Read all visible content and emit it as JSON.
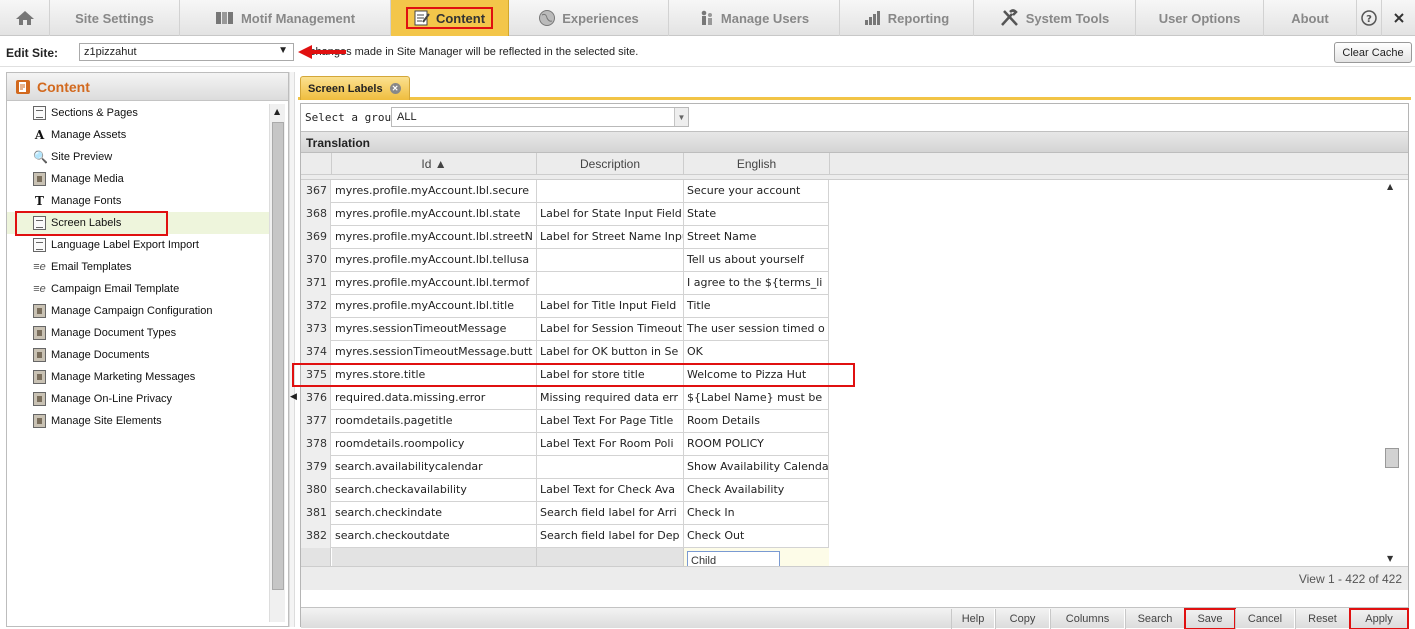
{
  "nav": {
    "items": [
      {
        "key": "home",
        "label": "",
        "icon": "home-icon"
      },
      {
        "key": "site_settings",
        "label": "Site Settings",
        "icon": ""
      },
      {
        "key": "motif",
        "label": "Motif Management",
        "icon": "motif-icon"
      },
      {
        "key": "content",
        "label": "Content",
        "icon": "content-icon",
        "active": true
      },
      {
        "key": "experiences",
        "label": "Experiences",
        "icon": "globe-icon"
      },
      {
        "key": "manage_users",
        "label": "Manage Users",
        "icon": "users-icon"
      },
      {
        "key": "reporting",
        "label": "Reporting",
        "icon": "bar-chart-icon"
      },
      {
        "key": "system_tools",
        "label": "System Tools",
        "icon": "tools-icon"
      },
      {
        "key": "user_options",
        "label": "User Options",
        "icon": ""
      },
      {
        "key": "about",
        "label": "About",
        "icon": ""
      },
      {
        "key": "help",
        "label": "",
        "icon": "help-icon"
      }
    ]
  },
  "editbar": {
    "label": "Edit Site:",
    "site_value": "z1pizzahut",
    "message": "changes made in Site Manager will be reflected in the selected site.",
    "clear_cache": "Clear Cache"
  },
  "left": {
    "title": "Content",
    "items": [
      {
        "label": "Sections & Pages",
        "icon": "doc"
      },
      {
        "label": "Manage Assets",
        "icon": "txt",
        "glyph": "A"
      },
      {
        "label": "Site Preview",
        "icon": "mag",
        "glyph": "🔍"
      },
      {
        "label": "Manage Media",
        "icon": "film"
      },
      {
        "label": "Manage Fonts",
        "icon": "txt",
        "glyph": "T"
      },
      {
        "label": "Screen Labels",
        "icon": "doc",
        "selected": true
      },
      {
        "label": "Language Label Export Import",
        "icon": "doc"
      },
      {
        "label": "Email Templates",
        "icon": "eml",
        "glyph": "≡e"
      },
      {
        "label": "Campaign Email Template",
        "icon": "eml",
        "glyph": "≡e"
      },
      {
        "label": "Manage Campaign Configuration",
        "icon": "film"
      },
      {
        "label": "Manage Document Types",
        "icon": "film"
      },
      {
        "label": "Manage Documents",
        "icon": "film"
      },
      {
        "label": "Manage Marketing Messages",
        "icon": "film"
      },
      {
        "label": "Manage On-Line Privacy",
        "icon": "film"
      },
      {
        "label": "Manage Site Elements",
        "icon": "film"
      }
    ]
  },
  "tab": {
    "label": "Screen Labels"
  },
  "grid": {
    "group_label": "Select a group:",
    "group_value": "ALL",
    "section_title": "Translation",
    "columns": {
      "id": "Id ▲",
      "description": "Description",
      "english": "English"
    },
    "rows": [
      {
        "num": "367",
        "id": "myres.profile.myAccount.lbl.secure",
        "desc": "",
        "eng": "Secure your account"
      },
      {
        "num": "368",
        "id": "myres.profile.myAccount.lbl.state",
        "desc": "Label for State Input Field",
        "eng": "State"
      },
      {
        "num": "369",
        "id": "myres.profile.myAccount.lbl.streetN",
        "desc": "Label for Street Name Input",
        "eng": "Street Name"
      },
      {
        "num": "370",
        "id": "myres.profile.myAccount.lbl.tellusa",
        "desc": "",
        "eng": "Tell us about yourself"
      },
      {
        "num": "371",
        "id": "myres.profile.myAccount.lbl.termof",
        "desc": "",
        "eng": "I agree to the ${terms_li"
      },
      {
        "num": "372",
        "id": "myres.profile.myAccount.lbl.title",
        "desc": "Label for Title Input Field",
        "eng": "Title"
      },
      {
        "num": "373",
        "id": "myres.sessionTimeoutMessage",
        "desc": "Label for Session Timeout",
        "eng": "The user session timed o"
      },
      {
        "num": "374",
        "id": "myres.sessionTimeoutMessage.butt",
        "desc": "Label for OK button in Se",
        "eng": "OK"
      },
      {
        "num": "375",
        "id": "myres.store.title",
        "desc": "Label for store title",
        "eng": "Welcome to Pizza Hut",
        "highlight": true
      },
      {
        "num": "376",
        "id": "required.data.missing.error",
        "desc": "Missing required data err",
        "eng": "${Label Name} must be"
      },
      {
        "num": "377",
        "id": "roomdetails.pagetitle",
        "desc": "Label Text For Page Title",
        "eng": "Room Details"
      },
      {
        "num": "378",
        "id": "roomdetails.roompolicy",
        "desc": "Label Text For Room Poli",
        "eng": "ROOM POLICY"
      },
      {
        "num": "379",
        "id": "search.availabilitycalendar",
        "desc": "",
        "eng": "Show Availability Calenda"
      },
      {
        "num": "380",
        "id": "search.checkavailability",
        "desc": "Label Text for Check Ava",
        "eng": "Check Availability"
      },
      {
        "num": "381",
        "id": "search.checkindate",
        "desc": "Search field label for Arri",
        "eng": "Check In"
      },
      {
        "num": "382",
        "id": "search.checkoutdate",
        "desc": "Search field label for Dep",
        "eng": "Check Out"
      }
    ],
    "edit_value": "Child",
    "view_count": "View 1 - 422 of 422"
  },
  "bottom": {
    "buttons": [
      {
        "key": "help",
        "label": "Help"
      },
      {
        "key": "copy",
        "label": "Copy"
      },
      {
        "key": "columns",
        "label": "Columns"
      },
      {
        "key": "search",
        "label": "Search"
      },
      {
        "key": "save",
        "label": "Save",
        "red": true
      },
      {
        "key": "cancel",
        "label": "Cancel"
      },
      {
        "key": "reset",
        "label": "Reset"
      },
      {
        "key": "apply",
        "label": "Apply",
        "red": true
      }
    ]
  },
  "colors": {
    "accent": "#f3c64a",
    "highlight": "#e01010",
    "title": "#d2691e"
  }
}
